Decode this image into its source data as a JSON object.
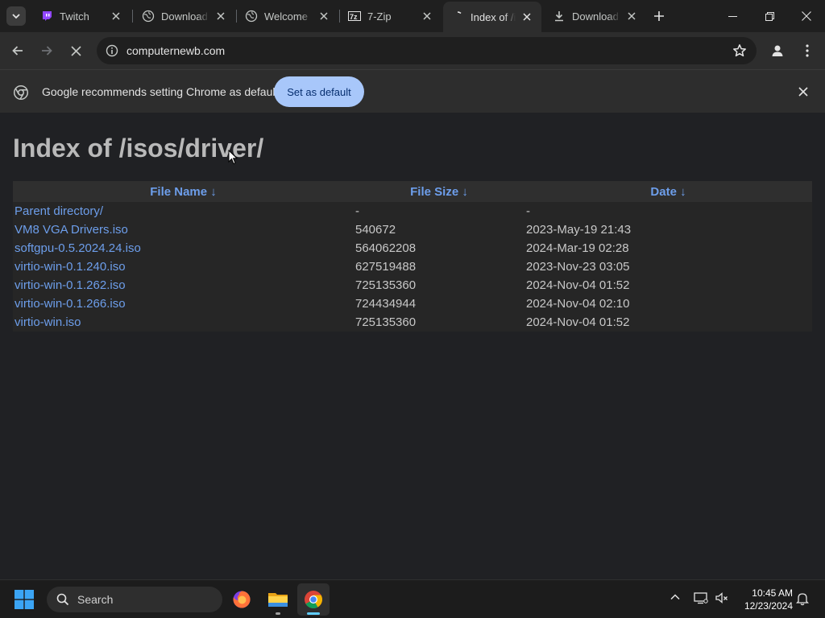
{
  "tabs": [
    {
      "title": "Twitch",
      "icon": "twitch-icon"
    },
    {
      "title": "Download",
      "icon": "loading-icon"
    },
    {
      "title": "Welcome",
      "icon": "loading-icon"
    },
    {
      "title": "7-Zip",
      "icon": "7zip-icon"
    },
    {
      "title": "Index of /i",
      "icon": "loading-icon",
      "active": true
    },
    {
      "title": "Download",
      "icon": "download-icon"
    }
  ],
  "toolbar": {
    "url": "computernewb.com"
  },
  "infobar": {
    "message": "Google recommends setting Chrome as default",
    "button_label": "Set as default"
  },
  "page": {
    "heading": "Index of /isos/driver/",
    "columns": [
      "File Name  ↓",
      "File Size  ↓",
      "Date  ↓"
    ],
    "rows": [
      {
        "name": "Parent directory/",
        "size": "-",
        "date": "-"
      },
      {
        "name": "VM8 VGA Drivers.iso",
        "size": "540672",
        "date": "2023-May-19 21:43"
      },
      {
        "name": "softgpu-0.5.2024.24.iso",
        "size": "564062208",
        "date": "2024-Mar-19 02:28"
      },
      {
        "name": "virtio-win-0.1.240.iso",
        "size": "627519488",
        "date": "2023-Nov-23 03:05"
      },
      {
        "name": "virtio-win-0.1.262.iso",
        "size": "725135360",
        "date": "2024-Nov-04 01:52"
      },
      {
        "name": "virtio-win-0.1.266.iso",
        "size": "724434944",
        "date": "2024-Nov-04 02:10"
      },
      {
        "name": "virtio-win.iso",
        "size": "725135360",
        "date": "2024-Nov-04 01:52"
      }
    ]
  },
  "taskbar": {
    "search_placeholder": "Search",
    "time": "10:45 AM",
    "date": "12/23/2024"
  },
  "colors": {
    "link": "#6d9eeb",
    "accent_button": "#a8c7fa",
    "page_bg": "#202124"
  }
}
